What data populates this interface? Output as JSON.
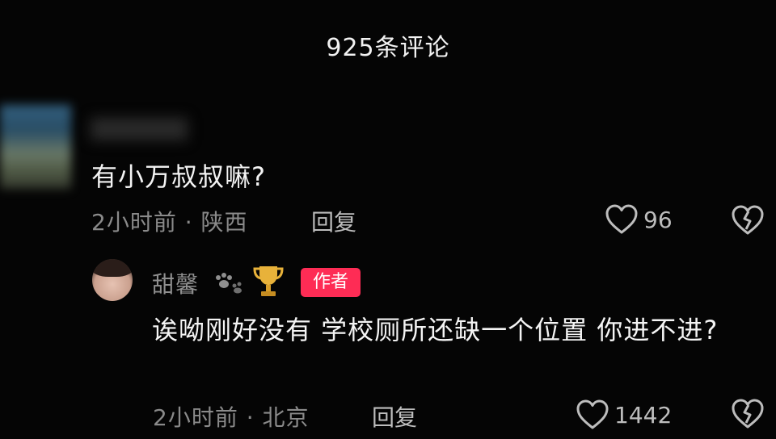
{
  "header": {
    "title": "925条评论"
  },
  "comment": {
    "text": "有小万叔叔嘛?",
    "time": "2小时前",
    "location": "陕西",
    "reply_label": "回复",
    "likes": "96"
  },
  "reply": {
    "username": "甜馨",
    "badge": "作者",
    "text": "诶呦刚好没有 学校厕所还缺一个位置 你进不进?",
    "time": "2小时前",
    "location": "北京",
    "reply_label": "回复",
    "likes": "1442"
  },
  "colors": {
    "background": "#050505",
    "author_badge": "#fe2c55",
    "muted_text": "#8a8a8a"
  },
  "icons": [
    "heart-icon",
    "broken-heart-icon",
    "trophy-icon",
    "paw-icon"
  ]
}
